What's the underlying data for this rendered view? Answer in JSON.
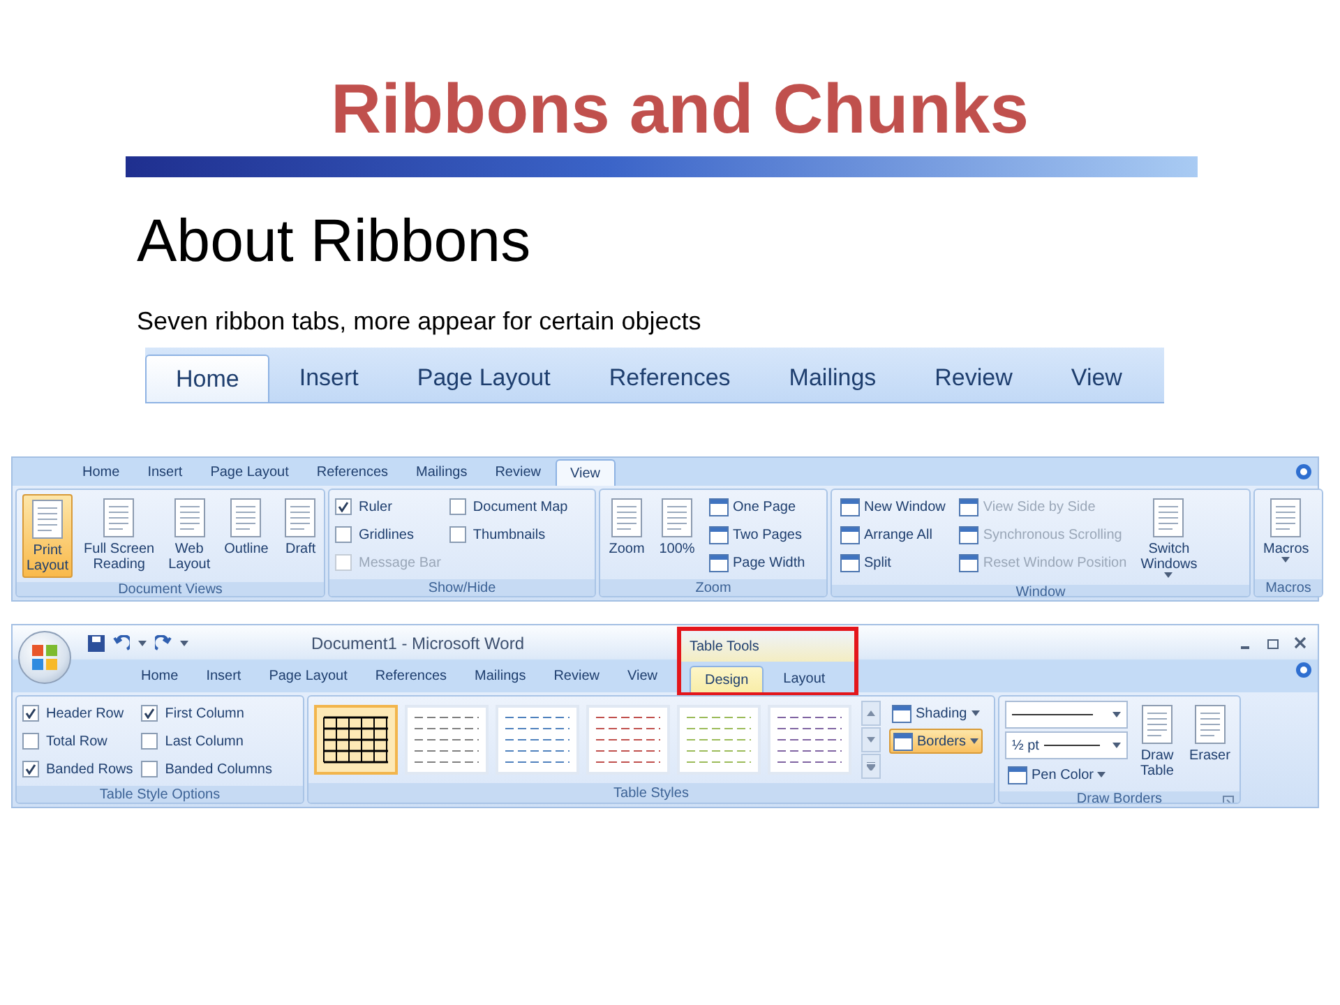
{
  "title": "Ribbons and Chunks",
  "heading": "About Ribbons",
  "caption": "Seven ribbon tabs, more appear for certain objects",
  "tab_strip": {
    "tabs": [
      {
        "label": "Home",
        "selected": true
      },
      {
        "label": "Insert",
        "selected": false
      },
      {
        "label": "Page Layout",
        "selected": false
      },
      {
        "label": "References",
        "selected": false
      },
      {
        "label": "Mailings",
        "selected": false
      },
      {
        "label": "Review",
        "selected": false
      },
      {
        "label": "View",
        "selected": false
      }
    ]
  },
  "view_ribbon": {
    "tabs": [
      {
        "label": "Home",
        "selected": false
      },
      {
        "label": "Insert",
        "selected": false
      },
      {
        "label": "Page Layout",
        "selected": false
      },
      {
        "label": "References",
        "selected": false
      },
      {
        "label": "Mailings",
        "selected": false
      },
      {
        "label": "Review",
        "selected": false
      },
      {
        "label": "View",
        "selected": true
      }
    ],
    "groups": [
      {
        "label": "Document Views",
        "columns": [
          [
            {
              "kind": "large",
              "label": "Print\nLayout",
              "selected": true,
              "dropdown": false
            }
          ],
          [
            {
              "kind": "large",
              "label": "Full Screen\nReading",
              "selected": false,
              "dropdown": false
            }
          ],
          [
            {
              "kind": "large",
              "label": "Web\nLayout",
              "selected": false,
              "dropdown": false
            }
          ],
          [
            {
              "kind": "large",
              "label": "Outline",
              "selected": false,
              "dropdown": false
            }
          ],
          [
            {
              "kind": "large",
              "label": "Draft",
              "selected": false,
              "dropdown": false
            }
          ]
        ]
      },
      {
        "label": "Show/Hide",
        "columns": [
          [
            {
              "kind": "check",
              "label": "Ruler",
              "checked": true,
              "disabled": false
            },
            {
              "kind": "check",
              "label": "Gridlines",
              "checked": false,
              "disabled": false
            },
            {
              "kind": "check",
              "label": "Message Bar",
              "checked": false,
              "disabled": true
            }
          ],
          [
            {
              "kind": "check",
              "label": "Document Map",
              "checked": false,
              "disabled": false
            },
            {
              "kind": "check",
              "label": "Thumbnails",
              "checked": false,
              "disabled": false
            }
          ]
        ]
      },
      {
        "label": "Zoom",
        "columns": [
          [
            {
              "kind": "large",
              "label": "Zoom",
              "selected": false,
              "dropdown": false
            }
          ],
          [
            {
              "kind": "large",
              "label": "100%",
              "selected": false,
              "dropdown": false
            }
          ],
          [
            {
              "kind": "small",
              "label": "One Page",
              "disabled": false,
              "dropdown": false,
              "selected": false
            },
            {
              "kind": "small",
              "label": "Two Pages",
              "disabled": false,
              "dropdown": false,
              "selected": false
            },
            {
              "kind": "small",
              "label": "Page Width",
              "disabled": false,
              "dropdown": false,
              "selected": false
            }
          ]
        ]
      },
      {
        "label": "Window",
        "columns": [
          [
            {
              "kind": "small",
              "label": "New Window",
              "disabled": false,
              "dropdown": false,
              "selected": false
            },
            {
              "kind": "small",
              "label": "Arrange All",
              "disabled": false,
              "dropdown": false,
              "selected": false
            },
            {
              "kind": "small",
              "label": "Split",
              "disabled": false,
              "dropdown": false,
              "selected": false
            }
          ],
          [
            {
              "kind": "small",
              "label": "View Side by Side",
              "disabled": true,
              "dropdown": false,
              "selected": false
            },
            {
              "kind": "small",
              "label": "Synchronous Scrolling",
              "disabled": true,
              "dropdown": false,
              "selected": false
            },
            {
              "kind": "small",
              "label": "Reset Window Position",
              "disabled": true,
              "dropdown": false,
              "selected": false
            }
          ],
          [
            {
              "kind": "large",
              "label": "Switch\nWindows",
              "selected": false,
              "dropdown": true
            }
          ]
        ]
      },
      {
        "label": "Macros",
        "columns": [
          [
            {
              "kind": "large",
              "label": "Macros",
              "selected": false,
              "dropdown": true
            }
          ]
        ]
      }
    ]
  },
  "design_ribbon": {
    "window_title": "Document1 - Microsoft Word",
    "tabs": [
      {
        "label": "Home",
        "selected": false
      },
      {
        "label": "Insert",
        "selected": false
      },
      {
        "label": "Page Layout",
        "selected": false
      },
      {
        "label": "References",
        "selected": false
      },
      {
        "label": "Mailings",
        "selected": false
      },
      {
        "label": "Review",
        "selected": false
      },
      {
        "label": "View",
        "selected": false
      }
    ],
    "context": {
      "label": "Table Tools",
      "tabs": [
        {
          "label": "Design",
          "selected": true
        },
        {
          "label": "Layout",
          "selected": false
        }
      ]
    },
    "groups": [
      {
        "label": "Table Style Options",
        "columns": [
          [
            {
              "kind": "check",
              "label": "Header Row",
              "checked": true,
              "disabled": false
            },
            {
              "kind": "check",
              "label": "Total Row",
              "checked": false,
              "disabled": false
            },
            {
              "kind": "check",
              "label": "Banded Rows",
              "checked": true,
              "disabled": false
            }
          ],
          [
            {
              "kind": "check",
              "label": "First Column",
              "checked": true,
              "disabled": false
            },
            {
              "kind": "check",
              "label": "Last Column",
              "checked": false,
              "disabled": false
            },
            {
              "kind": "check",
              "label": "Banded Columns",
              "checked": false,
              "disabled": false
            }
          ]
        ]
      },
      {
        "label": "Table Styles",
        "columns": [
          [
            {
              "kind": "gallery",
              "styles": [
                {
                  "color": "#000000",
                  "selected": true
                },
                {
                  "color": "#7f7f7f",
                  "selected": false
                },
                {
                  "color": "#4f81bd",
                  "selected": false
                },
                {
                  "color": "#c0504d",
                  "selected": false
                },
                {
                  "color": "#9bbb59",
                  "selected": false
                },
                {
                  "color": "#8064a2",
                  "selected": false
                }
              ]
            }
          ],
          [
            {
              "kind": "small",
              "label": "Shading",
              "disabled": false,
              "dropdown": true,
              "selected": false
            },
            {
              "kind": "small",
              "label": "Borders",
              "disabled": false,
              "dropdown": true,
              "selected": true
            }
          ]
        ]
      },
      {
        "label": "Draw Borders",
        "launcher": true,
        "columns": [
          [
            {
              "kind": "line_picker"
            },
            {
              "kind": "line_picker",
              "label": "½ pt"
            },
            {
              "kind": "small",
              "label": "Pen Color",
              "disabled": false,
              "dropdown": true,
              "selected": false
            }
          ],
          [
            {
              "kind": "large",
              "label": "Draw\nTable",
              "selected": false,
              "dropdown": false
            }
          ],
          [
            {
              "kind": "large",
              "label": "Eraser",
              "selected": false,
              "dropdown": false
            }
          ]
        ]
      }
    ]
  }
}
